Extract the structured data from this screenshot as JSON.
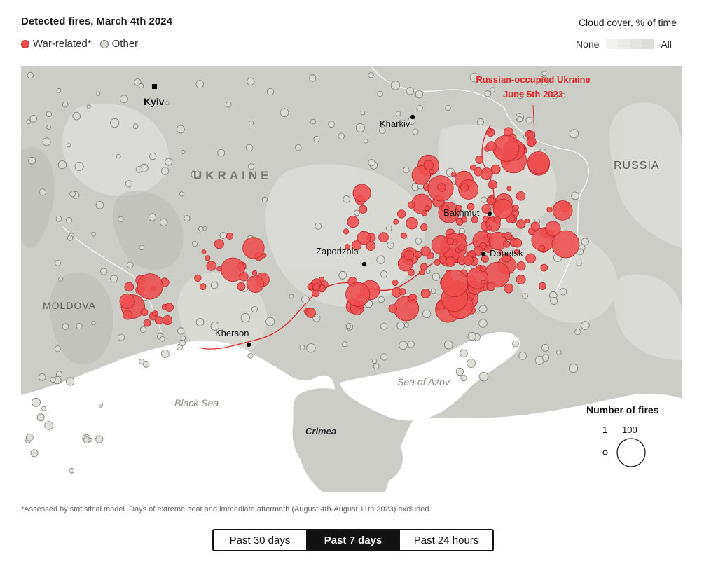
{
  "header": {
    "title": "Detected fires, March 4th 2024",
    "legend_war": "War-related*",
    "legend_other": "Other",
    "cloud_title": "Cloud cover, % of time",
    "cloud_min": "None",
    "cloud_max": "All"
  },
  "colors": {
    "war": "#ee4d4d",
    "war_stroke": "#b82828",
    "other_fill": "#dcdcd6",
    "other_stroke": "#7d7d78",
    "land": "#c9c9c4",
    "land_light": "#dedeD8",
    "sea": "#ffffff",
    "occupation_line": "#e3262b"
  },
  "map_labels": {
    "ukraine": "UKRAINE",
    "russia": "RUSSIA",
    "moldova": "MOLDOVA",
    "black_sea": "Black Sea",
    "sea_of_azov": "Sea of Azov",
    "crimea": "Crimea",
    "occupied_line1": "Russian-occupied Ukraine",
    "occupied_line2": "June 5th 2023"
  },
  "cities": [
    {
      "name": "Kyiv",
      "capital": true
    },
    {
      "name": "Kharkiv"
    },
    {
      "name": "Bakhmut"
    },
    {
      "name": "Zaporizhia"
    },
    {
      "name": "Donetsk"
    },
    {
      "name": "Kherson"
    }
  ],
  "size_legend": {
    "title": "Number of fires",
    "small": "1",
    "large": "100"
  },
  "footnote": "*Assessed by statistical model. Days of extreme heat and immediate aftermath (August 4th-August 11th 2023) excluded.",
  "toggle": {
    "options": [
      "Past 30 days",
      "Past 7 days",
      "Past 24 hours"
    ],
    "selected": "Past 7 days"
  }
}
